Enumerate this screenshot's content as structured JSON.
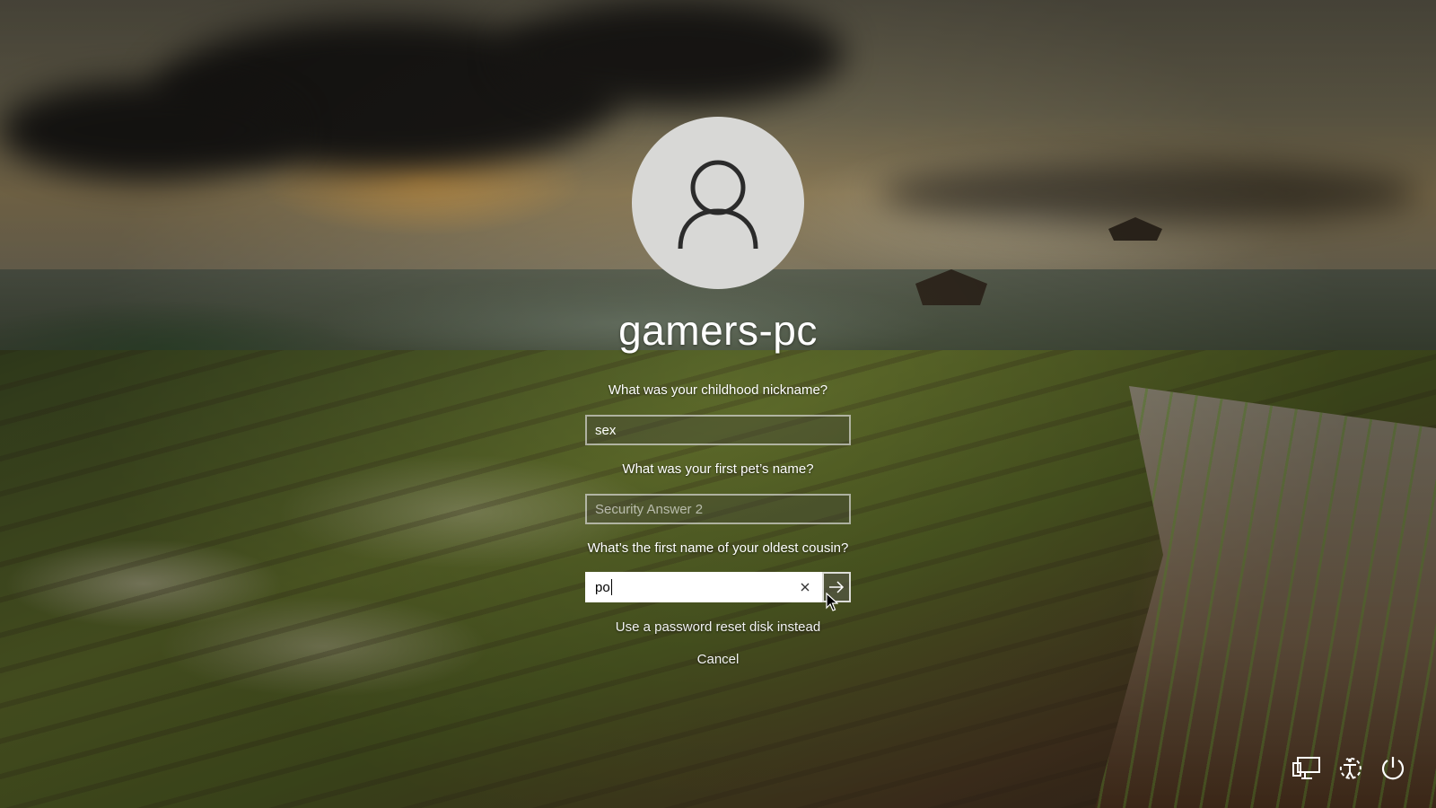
{
  "user": {
    "name": "gamers-pc"
  },
  "questions": [
    {
      "label": "What was your childhood nickname?",
      "value": "sex",
      "placeholder": ""
    },
    {
      "label": "What was your first pet’s name?",
      "value": "",
      "placeholder": "Security Answer 2"
    },
    {
      "label": "What’s the first name of your oldest cousin?",
      "value": "po",
      "placeholder": ""
    }
  ],
  "links": {
    "reset_disk": "Use a password reset disk instead",
    "cancel": "Cancel"
  },
  "tray": [
    "network-icon",
    "ease-of-access-icon",
    "power-icon"
  ],
  "colors": {
    "field_border": "#ffffff",
    "avatar_bg": "#d8d8d6",
    "icon_stroke": "#2b2b2b"
  }
}
